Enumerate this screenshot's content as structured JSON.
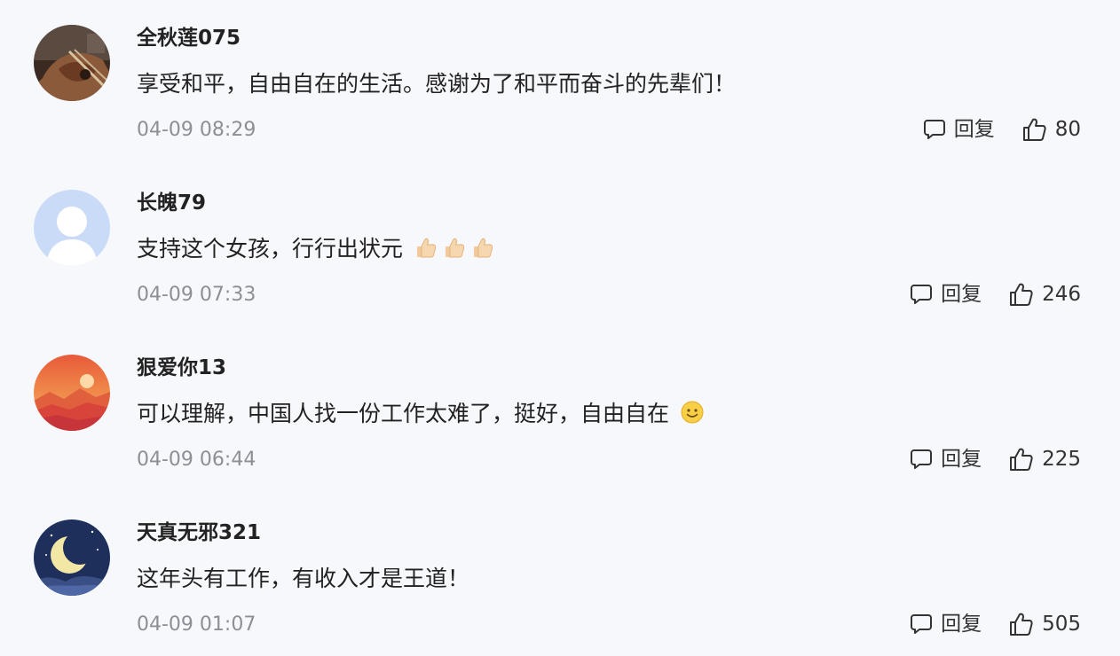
{
  "comments": [
    {
      "username": "全秋莲075",
      "text": "享受和平，自由自在的生活。感谢为了和平而奋斗的先辈们！",
      "emoji_count": 0,
      "emoji": "",
      "time": "04-09 08:29",
      "reply_label": "回复",
      "likes": "80",
      "avatar": "violin-photo"
    },
    {
      "username": "长魄79",
      "text": "支持这个女孩，行行出状元",
      "emoji_count": 3,
      "emoji": "thumbs-up-emoji",
      "time": "04-09 07:33",
      "reply_label": "回复",
      "likes": "246",
      "avatar": "default-user"
    },
    {
      "username": "狠爱你13",
      "text": "可以理解，中国人找一份工作太难了，挺好，自由自在",
      "emoji_count": 1,
      "emoji": "smile-emoji",
      "time": "04-09 06:44",
      "reply_label": "回复",
      "likes": "225",
      "avatar": "sunset-landscape"
    },
    {
      "username": "天真无邪321",
      "text": "这年头有工作，有收入才是王道！",
      "emoji_count": 0,
      "emoji": "",
      "time": "04-09 01:07",
      "reply_label": "回复",
      "likes": "505",
      "avatar": "crescent-moon-night"
    }
  ],
  "icons": {
    "reply": "comment-bubble-icon",
    "like": "thumbs-up-icon"
  },
  "colors": {
    "background": "#f7f8fb",
    "text": "#222222",
    "meta": "#8c8f95"
  }
}
